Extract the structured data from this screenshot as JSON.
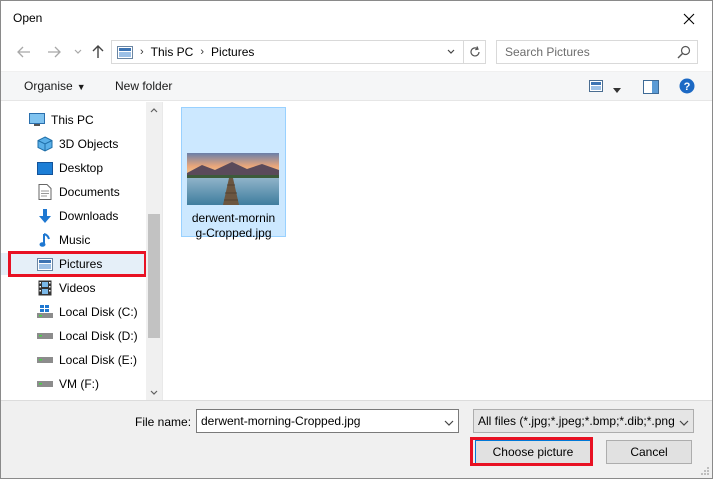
{
  "window": {
    "title": "Open"
  },
  "address": {
    "crumbs": [
      "This PC",
      "Pictures"
    ]
  },
  "search": {
    "placeholder": "Search Pictures"
  },
  "toolbar": {
    "organise": "Organise",
    "new_folder": "New folder"
  },
  "nav": {
    "items": [
      {
        "label": "This PC",
        "icon": "computer-icon"
      },
      {
        "label": "3D Objects",
        "icon": "cube-icon"
      },
      {
        "label": "Desktop",
        "icon": "desktop-icon"
      },
      {
        "label": "Documents",
        "icon": "document-icon"
      },
      {
        "label": "Downloads",
        "icon": "download-arrow-icon"
      },
      {
        "label": "Music",
        "icon": "music-note-icon"
      },
      {
        "label": "Pictures",
        "icon": "pictures-icon"
      },
      {
        "label": "Videos",
        "icon": "film-icon"
      },
      {
        "label": "Local Disk (C:)",
        "icon": "os-drive-icon"
      },
      {
        "label": "Local Disk (D:)",
        "icon": "drive-icon"
      },
      {
        "label": "Local Disk (E:)",
        "icon": "drive-icon"
      },
      {
        "label": "VM (F:)",
        "icon": "drive-icon"
      }
    ],
    "selected": "Pictures"
  },
  "files": [
    {
      "name_line1": "derwent-mornin",
      "name_line2": "g-Cropped.jpg",
      "icon": "landscape-thumbnail"
    }
  ],
  "footer": {
    "file_name_label": "File name:",
    "file_name_value": "derwent-morning-Cropped.jpg",
    "filter": "All files (*.jpg;*.jpeg;*.bmp;*.dib;*.png",
    "choose": "Choose picture",
    "cancel": "Cancel"
  },
  "colors": {
    "accent": "#0078d7",
    "highlight": "#e81123",
    "selection": "#cce8ff"
  }
}
